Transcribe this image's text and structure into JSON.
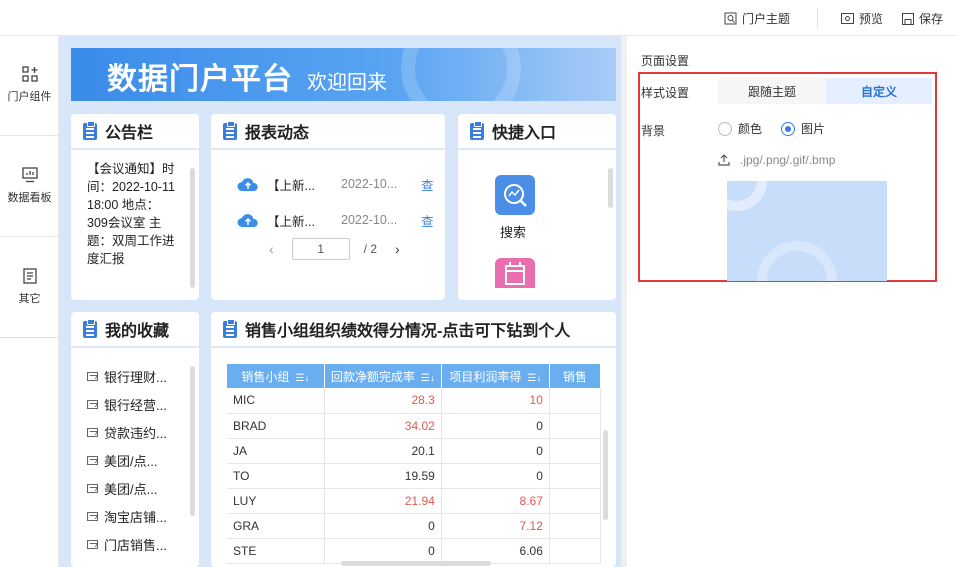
{
  "topbar": {
    "theme_label": "门户主题",
    "preview_label": "预览",
    "save_label": "保存"
  },
  "sidebar": {
    "items": [
      {
        "label": "门户组件",
        "icon": "grid-plus-icon"
      },
      {
        "label": "数据看板",
        "icon": "monitor-chart-icon"
      },
      {
        "label": "其它",
        "icon": "list-doc-icon"
      }
    ]
  },
  "banner": {
    "title": "数据门户平台",
    "subtitle": "欢迎回来"
  },
  "notice": {
    "title": "公告栏",
    "text": "【会议通知】时间：2022-10-11 18:00 地点：309会议室 主题：双周工作进度汇报"
  },
  "reports": {
    "title": "报表动态",
    "rows": [
      {
        "name": "【上新...",
        "date": "2022-10...",
        "action": "查"
      },
      {
        "name": "【上新...",
        "date": "2022-10...",
        "action": "查"
      }
    ],
    "pager": {
      "current": "1",
      "total": "/ 2"
    }
  },
  "quick": {
    "title": "快捷入口",
    "items": [
      {
        "label": "搜索",
        "icon": "search-chart-icon"
      },
      {
        "label": "",
        "icon": "calendar-icon"
      }
    ]
  },
  "favorites": {
    "title": "我的收藏",
    "items": [
      "银行理财...",
      "银行经营...",
      "贷款违约...",
      "美团/点...",
      "美团/点...",
      "淘宝店铺...",
      "门店销售..."
    ]
  },
  "sales": {
    "title": "销售小组组织绩效得分情况-点击可下钻到个人",
    "columns": [
      "销售小组",
      "回款净额完成率",
      "项目利润率得",
      "销售"
    ],
    "rows": [
      {
        "group": "MIC",
        "a": "28.3",
        "b": "10",
        "a_red": true,
        "b_red": true
      },
      {
        "group": "BRAD",
        "a": "34.02",
        "b": "0",
        "a_red": true,
        "b_red": false
      },
      {
        "group": "JA",
        "a": "20.1",
        "b": "0",
        "a_red": false,
        "b_red": false
      },
      {
        "group": "TO",
        "a": "19.59",
        "b": "0",
        "a_red": false,
        "b_red": false
      },
      {
        "group": "LUY",
        "a": "21.94",
        "b": "8.67",
        "a_red": true,
        "b_red": true
      },
      {
        "group": "GRA",
        "a": "0",
        "b": "7.12",
        "a_red": false,
        "b_red": true
      },
      {
        "group": "STE",
        "a": "0",
        "b": "6.06",
        "a_red": false,
        "b_red": false
      }
    ]
  },
  "settings": {
    "section_title": "页面设置",
    "style_label": "样式设置",
    "style_options": [
      "跟随主题",
      "自定义"
    ],
    "style_selected": "自定义",
    "bg_label": "背景",
    "bg_options": [
      "颜色",
      "图片"
    ],
    "bg_selected": "图片",
    "upload_hint": ".jpg/.png/.gif/.bmp"
  },
  "colors": {
    "accent": "#3a7de0",
    "header_blue": "#6aaef2",
    "negative": "#e05a4f",
    "highlight": "#e23a3a"
  }
}
